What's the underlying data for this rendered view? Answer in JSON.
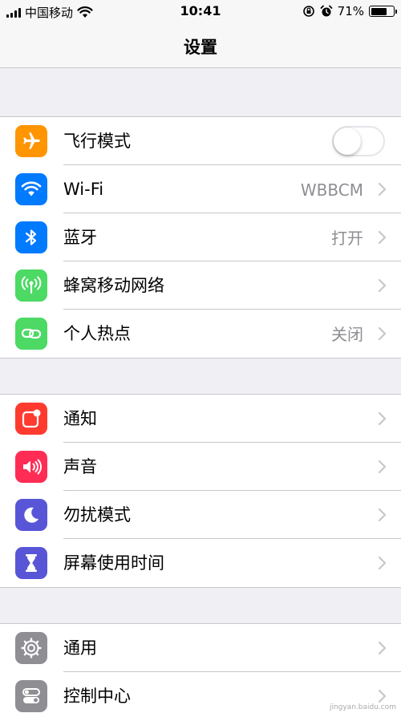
{
  "status_bar": {
    "carrier": "中国移动",
    "time": "10:41",
    "battery_percent": "71%",
    "battery_level": 0.71
  },
  "nav": {
    "title": "设置"
  },
  "groups": [
    {
      "rows": [
        {
          "label": "飞行模式",
          "icon": "airplane-icon",
          "icon_color": "#ff9500",
          "control": "toggle",
          "toggle_on": false
        },
        {
          "label": "Wi-Fi",
          "value": "WBBCM",
          "icon": "wifi-icon",
          "icon_color": "#007aff"
        },
        {
          "label": "蓝牙",
          "value": "打开",
          "icon": "bluetooth-icon",
          "icon_color": "#007aff"
        },
        {
          "label": "蜂窝移动网络",
          "icon": "cellular-icon",
          "icon_color": "#4cd964"
        },
        {
          "label": "个人热点",
          "value": "关闭",
          "icon": "hotspot-icon",
          "icon_color": "#4cd964"
        }
      ]
    },
    {
      "rows": [
        {
          "label": "通知",
          "icon": "notifications-icon",
          "icon_color": "#ff3b30"
        },
        {
          "label": "声音",
          "icon": "sound-icon",
          "icon_color": "#ff2d55"
        },
        {
          "label": "勿扰模式",
          "icon": "moon-icon",
          "icon_color": "#5856d6"
        },
        {
          "label": "屏幕使用时间",
          "icon": "hourglass-icon",
          "icon_color": "#5856d6"
        }
      ]
    },
    {
      "rows": [
        {
          "label": "通用",
          "icon": "gear-icon",
          "icon_color": "#8e8e93"
        },
        {
          "label": "控制中心",
          "icon": "switches-icon",
          "icon_color": "#8e8e93"
        }
      ]
    }
  ],
  "watermark": "jingyan.baidu.com"
}
